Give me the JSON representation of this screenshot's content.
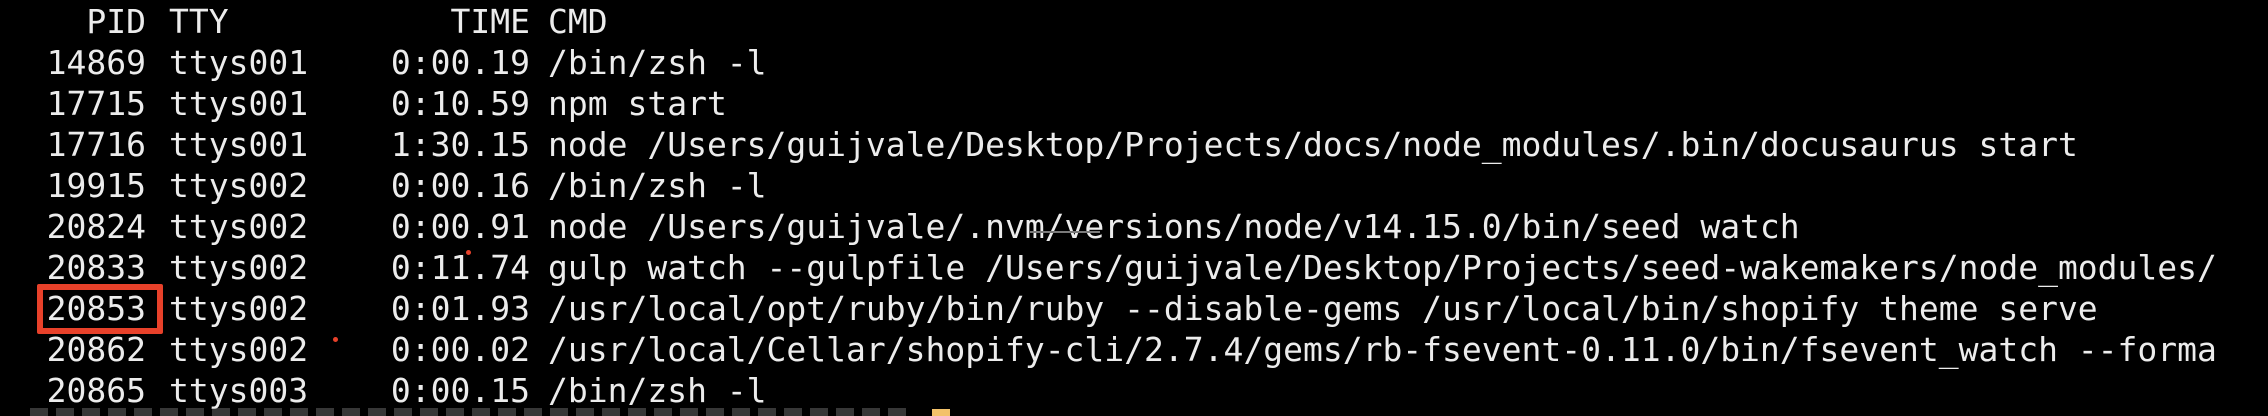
{
  "header": {
    "pid": "PID",
    "tty": "TTY",
    "time": "TIME",
    "cmd": "CMD"
  },
  "processes": [
    {
      "pid": "14869",
      "tty": "ttys001",
      "time": "0:00.19",
      "cmd": "/bin/zsh -l"
    },
    {
      "pid": "17715",
      "tty": "ttys001",
      "time": "0:10.59",
      "cmd": "npm start"
    },
    {
      "pid": "17716",
      "tty": "ttys001",
      "time": "1:30.15",
      "cmd": "node /Users/guijvale/Desktop/Projects/docs/node_modules/.bin/docusaurus start"
    },
    {
      "pid": "19915",
      "tty": "ttys002",
      "time": "0:00.16",
      "cmd": "/bin/zsh -l"
    },
    {
      "pid": "20824",
      "tty": "ttys002",
      "time": "0:00.91",
      "cmd": "node /Users/guijvale/.nvm/versions/node/v14.15.0/bin/seed watch"
    },
    {
      "pid": "20833",
      "tty": "ttys002",
      "time": "0:11.74",
      "cmd": "gulp watch --gulpfile /Users/guijvale/Desktop/Projects/seed-wakemakers/node_modules/"
    },
    {
      "pid": "20853",
      "tty": "ttys002",
      "time": "0:01.93",
      "cmd": "/usr/local/opt/ruby/bin/ruby --disable-gems /usr/local/bin/shopify theme serve"
    },
    {
      "pid": "20862",
      "tty": "ttys002",
      "time": "0:00.02",
      "cmd": "/usr/local/Cellar/shopify-cli/2.7.4/gems/rb-fsevent-0.11.0/bin/fsevent_watch --forma"
    },
    {
      "pid": "20865",
      "tty": "ttys003",
      "time": "0:00.15",
      "cmd": "/bin/zsh -l"
    }
  ],
  "highlighted_pid": "20853",
  "colors": {
    "background": "#000000",
    "text": "#ECECEC",
    "highlight": "#E8412A",
    "cursor": "#F3C26A"
  }
}
